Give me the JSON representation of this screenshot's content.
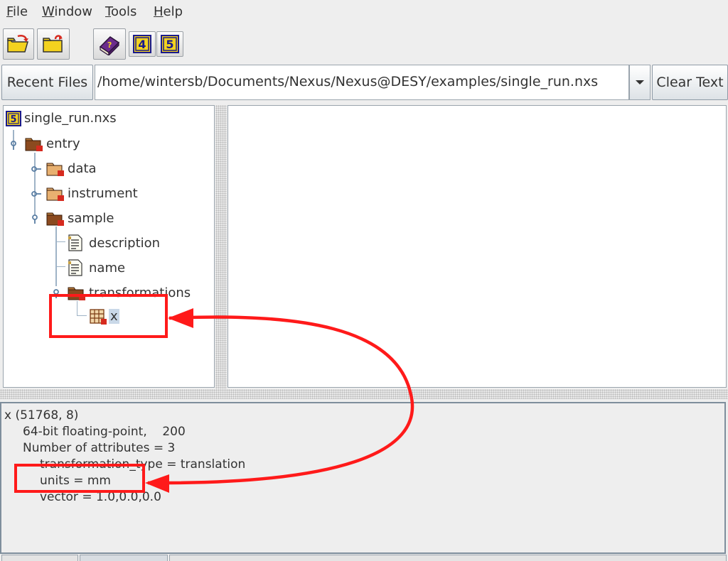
{
  "menu": {
    "items": [
      {
        "mnemonic": "F",
        "rest": "ile"
      },
      {
        "mnemonic": "W",
        "rest": "indow"
      },
      {
        "mnemonic": "T",
        "rest": "ools"
      },
      {
        "mnemonic": "H",
        "rest": "elp"
      }
    ]
  },
  "toolbar": {
    "buttons": [
      "open-folder-icon",
      "close-folder-icon",
      "help-book-icon",
      "hdf4-icon",
      "hdf5-icon"
    ],
    "hdf4_glyph": "4",
    "hdf5_glyph": "5"
  },
  "pathbar": {
    "recent_label": "Recent Files",
    "path": "/home/wintersb/Documents/Nexus/Nexus@DESY/examples/single_run.nxs",
    "clear_label": "Clear Text"
  },
  "tree": {
    "root": "single_run.nxs",
    "entry": "entry",
    "data": "data",
    "instrument": "instrument",
    "sample": "sample",
    "description": "description",
    "name": "name",
    "transformations": "transformations",
    "x": "x"
  },
  "info": {
    "lines": [
      "x (51768, 8)",
      "64-bit floating-point,    200",
      "Number of attributes = 3",
      "transformation_type = translation",
      "units = mm",
      "vector = 1.0,0.0,0.0"
    ]
  },
  "colors": {
    "annotation": "#ff1a1a",
    "hdf_badge": "#1a1a8c",
    "hdf_badge_bg": "#f3d21f",
    "folder": "#8b4a1f",
    "selection": "#c9d8e8"
  }
}
